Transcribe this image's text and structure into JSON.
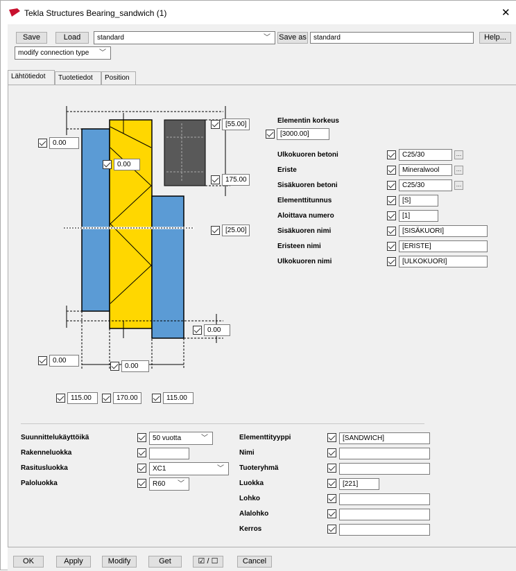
{
  "window": {
    "title": "Tekla Structures  Bearing_sandwich (1)",
    "close": "✕"
  },
  "toolbar": {
    "save_label": "Save",
    "load_label": "Load",
    "preset_value": "standard",
    "save_as_label": "Save as",
    "save_as_value": "standard",
    "help_label": "Help...",
    "connection_type": "modify connection type"
  },
  "tabs": [
    "Lähtötiedot",
    "Tuotetiedot",
    "Position"
  ],
  "diagram": {
    "top_dim": "[55.00]",
    "left_top_dim": "0.00",
    "inner_top_dim": "0.00",
    "mid_dim": "175.00",
    "bottom_right_dim": "[25.00]",
    "right_low_dim": "0.00",
    "left_low_dim": "0.00",
    "inner_low_dim": "0.00",
    "width_left": "115.00",
    "width_mid": "170.00",
    "width_right": "115.00"
  },
  "element_height": {
    "label": "Elementin korkeus",
    "value": "[3000.00]"
  },
  "fields": [
    {
      "label": "Ulkokuoren betoni",
      "value": "C25/30",
      "browse": true
    },
    {
      "label": "Eriste",
      "value": "Mineralwool",
      "browse": true
    },
    {
      "label": "Sisäkuoren betoni",
      "value": "C25/30",
      "browse": true
    },
    {
      "label": "Elementtitunnus",
      "value": "[S]"
    },
    {
      "label": "Aloittava numero",
      "value": "[1]"
    },
    {
      "label": "Sisäkuoren nimi",
      "value": "[SISÄKUORI]"
    },
    {
      "label": "Eristeen nimi",
      "value": "[ERISTE]"
    },
    {
      "label": "Ulkokuoren nimi",
      "value": "[ULKOKUORI]"
    }
  ],
  "left_props": [
    {
      "label": "Suunnittelukäyttöikä",
      "value": "50 vuotta",
      "type": "select"
    },
    {
      "label": "Rakenneluokka",
      "value": "",
      "type": "input"
    },
    {
      "label": "Rasitusluokka",
      "value": "XC1",
      "type": "select"
    },
    {
      "label": "Paloluokka",
      "value": "R60",
      "type": "select"
    }
  ],
  "right_props": [
    {
      "label": "Elementtityyppi",
      "value": "[SANDWICH]"
    },
    {
      "label": "Nimi",
      "value": ""
    },
    {
      "label": "Tuoteryhmä",
      "value": ""
    },
    {
      "label": "Luokka",
      "value": "[221]"
    },
    {
      "label": "Lohko",
      "value": ""
    },
    {
      "label": "Alalohko",
      "value": ""
    },
    {
      "label": "Kerros",
      "value": ""
    }
  ],
  "bottom": {
    "ok": "OK",
    "apply": "Apply",
    "modify": "Modify",
    "get": "Get",
    "toggle": "☑ / ☐",
    "cancel": "Cancel"
  },
  "colors": {
    "concrete": "#5b9bd5",
    "insulation": "#ffd700",
    "dark": "#595959"
  }
}
